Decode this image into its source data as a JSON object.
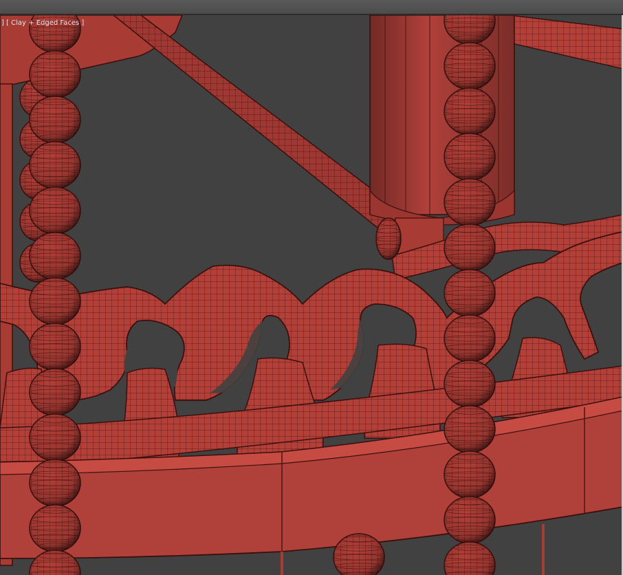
{
  "viewport": {
    "label": "] [ Clay + Edged Faces ]",
    "background": "#414141",
    "model_color": "#b0403a",
    "wire_color": "#4a1512"
  }
}
